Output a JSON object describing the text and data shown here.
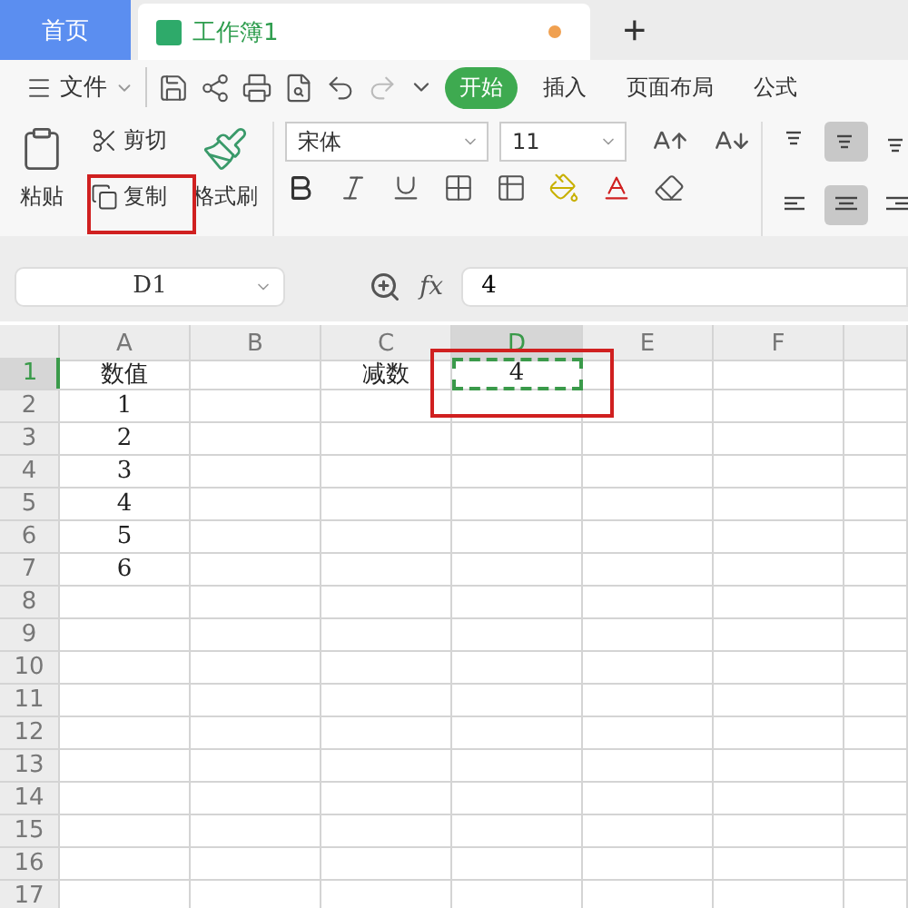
{
  "tabs": [
    {
      "label": "首页",
      "kind": "home",
      "selected": false
    },
    {
      "label": "工作簿1",
      "kind": "document",
      "selected": true,
      "unsaved": true
    }
  ],
  "new_tab": "+",
  "menu": {
    "file": "文件",
    "ribbon_tabs": [
      {
        "label": "开始",
        "selected": true
      },
      {
        "label": "插入",
        "selected": false
      },
      {
        "label": "页面布局",
        "selected": false
      },
      {
        "label": "公式",
        "selected": false
      }
    ]
  },
  "clipboard": {
    "paste": "粘贴",
    "cut": "剪切",
    "copy": "复制",
    "format_painter": "格式刷"
  },
  "font": {
    "name": "宋体",
    "size": "11"
  },
  "align_buttons": [
    {
      "kind": "top",
      "selected": false
    },
    {
      "kind": "middle",
      "selected": true
    },
    {
      "kind": "bottom",
      "selected": false
    },
    {
      "kind": "left",
      "selected": false
    },
    {
      "kind": "center",
      "selected": true
    },
    {
      "kind": "right",
      "selected": false
    }
  ],
  "formula_bar": {
    "name_box": "D1",
    "fx": "fx",
    "value": "4"
  },
  "sheet": {
    "columns": [
      {
        "label": "A",
        "selected": false
      },
      {
        "label": "B",
        "selected": false
      },
      {
        "label": "C",
        "selected": false
      },
      {
        "label": "D",
        "selected": true
      },
      {
        "label": "E",
        "selected": false
      },
      {
        "label": "F",
        "selected": false
      }
    ],
    "rows": [
      {
        "label": "1",
        "selected": true,
        "cells": [
          {
            "text": "数值",
            "selected": false
          },
          {
            "text": "",
            "selected": false
          },
          {
            "text": "减数",
            "selected": false
          },
          {
            "text": "4",
            "selected": true
          }
        ]
      },
      {
        "label": "2",
        "selected": false,
        "cells": [
          {
            "text": "1",
            "selected": false
          }
        ]
      },
      {
        "label": "3",
        "selected": false,
        "cells": [
          {
            "text": "2",
            "selected": false
          }
        ]
      },
      {
        "label": "4",
        "selected": false,
        "cells": [
          {
            "text": "3",
            "selected": false
          }
        ]
      },
      {
        "label": "5",
        "selected": false,
        "cells": [
          {
            "text": "4",
            "selected": false
          }
        ]
      },
      {
        "label": "6",
        "selected": false,
        "cells": [
          {
            "text": "5",
            "selected": false
          }
        ]
      },
      {
        "label": "7",
        "selected": false,
        "cells": [
          {
            "text": "6",
            "selected": false
          }
        ]
      },
      {
        "label": "8",
        "selected": false
      },
      {
        "label": "9",
        "selected": false
      },
      {
        "label": "10",
        "selected": false
      },
      {
        "label": "11",
        "selected": false
      },
      {
        "label": "12",
        "selected": false
      },
      {
        "label": "13",
        "selected": false
      },
      {
        "label": "14",
        "selected": false
      },
      {
        "label": "15",
        "selected": false
      },
      {
        "label": "16",
        "selected": false
      },
      {
        "label": "17",
        "selected": false
      }
    ]
  }
}
